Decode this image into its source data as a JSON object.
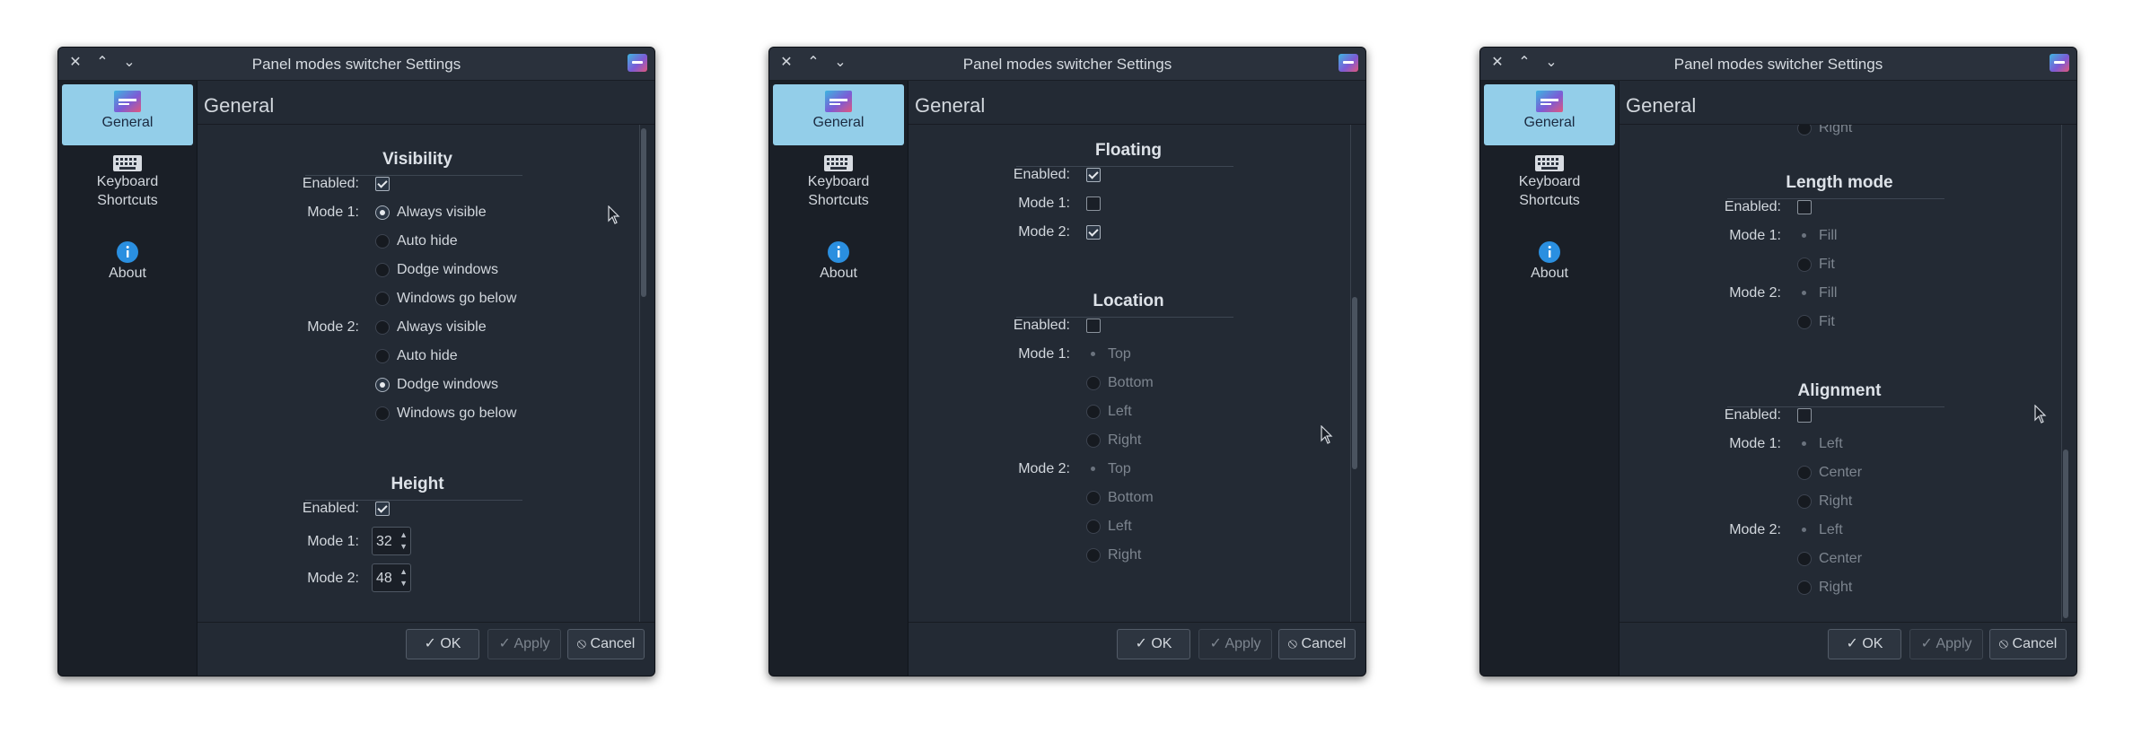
{
  "windows": [
    {
      "title": "Panel modes switcher Settings",
      "page_title": "General",
      "sidebar": [
        {
          "label": "General",
          "icon": "panel-modes-icon",
          "active": true
        },
        {
          "label": "Keyboard\nShortcuts",
          "icon": "keyboard-icon",
          "active": false
        },
        {
          "label": "About",
          "icon": "info-icon",
          "active": false
        }
      ],
      "buttons": {
        "ok": "OK",
        "apply": "Apply",
        "cancel": "Cancel"
      },
      "sections": {
        "visibility": {
          "title": "Visibility",
          "enabled_label": "Enabled:",
          "enabled": true,
          "mode1_label": "Mode 1:",
          "mode2_label": "Mode 2:",
          "mode1_options": [
            "Always visible",
            "Auto hide",
            "Dodge windows",
            "Windows go below"
          ],
          "mode2_options": [
            "Always visible",
            "Auto hide",
            "Dodge windows",
            "Windows go below"
          ],
          "mode1_selected": "Always visible",
          "mode2_selected": "Dodge windows"
        },
        "height": {
          "title": "Height",
          "enabled_label": "Enabled:",
          "enabled": true,
          "mode1_label": "Mode 1:",
          "mode2_label": "Mode 2:",
          "mode1_value": "32",
          "mode2_value": "48"
        }
      }
    },
    {
      "title": "Panel modes switcher Settings",
      "page_title": "General",
      "sidebar": [
        {
          "label": "General",
          "icon": "panel-modes-icon",
          "active": true
        },
        {
          "label": "Keyboard\nShortcuts",
          "icon": "keyboard-icon",
          "active": false
        },
        {
          "label": "About",
          "icon": "info-icon",
          "active": false
        }
      ],
      "buttons": {
        "ok": "OK",
        "apply": "Apply",
        "cancel": "Cancel"
      },
      "sections": {
        "floating": {
          "title": "Floating",
          "enabled_label": "Enabled:",
          "enabled": true,
          "mode1_label": "Mode 1:",
          "mode1_checked": false,
          "mode2_label": "Mode 2:",
          "mode2_checked": true
        },
        "location": {
          "title": "Location",
          "enabled_label": "Enabled:",
          "enabled": false,
          "mode1_label": "Mode 1:",
          "mode2_label": "Mode 2:",
          "mode1_options": [
            "Top",
            "Bottom",
            "Left",
            "Right"
          ],
          "mode2_options": [
            "Top",
            "Bottom",
            "Left",
            "Right"
          ],
          "mode1_selected": "Top",
          "mode2_selected": "Top"
        }
      }
    },
    {
      "title": "Panel modes switcher Settings",
      "page_title": "General",
      "sidebar": [
        {
          "label": "General",
          "icon": "panel-modes-icon",
          "active": true
        },
        {
          "label": "Keyboard\nShortcuts",
          "icon": "keyboard-icon",
          "active": false
        },
        {
          "label": "About",
          "icon": "info-icon",
          "active": false
        }
      ],
      "buttons": {
        "ok": "OK",
        "apply": "Apply",
        "cancel": "Cancel"
      },
      "sections": {
        "prev_tail": {
          "option": "Right"
        },
        "length_mode": {
          "title": "Length mode",
          "enabled_label": "Enabled:",
          "enabled": false,
          "mode1_label": "Mode 1:",
          "mode2_label": "Mode 2:",
          "mode1_options": [
            "Fill",
            "Fit"
          ],
          "mode2_options": [
            "Fill",
            "Fit"
          ],
          "mode1_selected": "Fill",
          "mode2_selected": "Fill"
        },
        "alignment": {
          "title": "Alignment",
          "enabled_label": "Enabled:",
          "enabled": false,
          "mode1_label": "Mode 1:",
          "mode2_label": "Mode 2:",
          "mode1_options": [
            "Left",
            "Center",
            "Right"
          ],
          "mode2_options": [
            "Left",
            "Center",
            "Right"
          ],
          "mode1_selected": "Left",
          "mode2_selected": "Left"
        }
      }
    }
  ],
  "colors": {
    "window_bg": "#232a34",
    "sidebar_bg": "#1a1f27",
    "sidebar_active": "#93cee9",
    "text": "#d2d7dd",
    "disabled_text": "#7d858f"
  }
}
